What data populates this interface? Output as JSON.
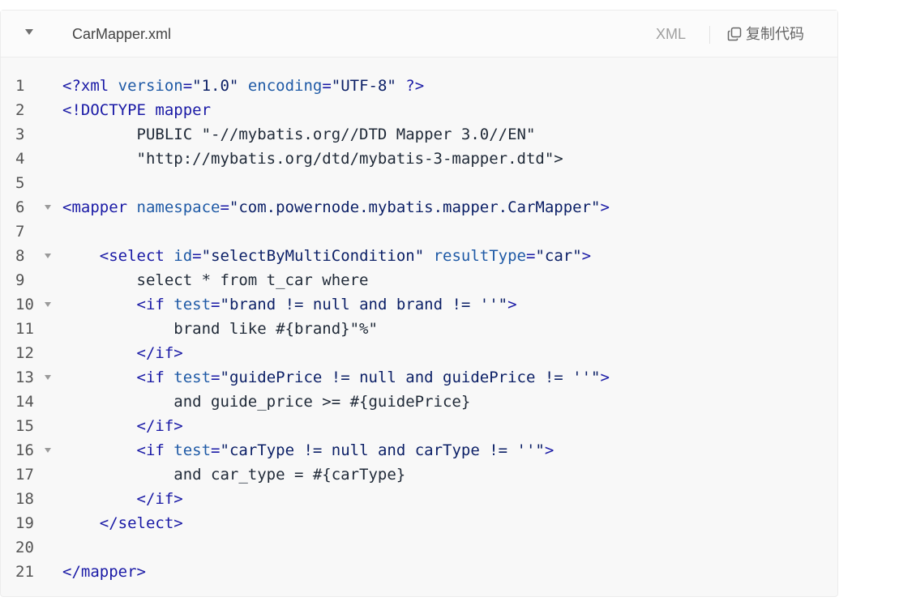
{
  "header": {
    "file_name": "CarMapper.xml",
    "language": "XML",
    "copy_label": "复制代码",
    "collapse_icon": "chevron-down-icon",
    "copy_icon": "copy-icon"
  },
  "colors": {
    "tag": "#1a1aa6",
    "attribute": "#1f5aa6",
    "string": "#0b1f66",
    "text": "#1f2937",
    "line_number": "#555555",
    "background": "#f8f8f8"
  },
  "lines": [
    {
      "number": "1",
      "fold": false,
      "text": "<?xml version=\"1.0\" encoding=\"UTF-8\" ?>"
    },
    {
      "number": "2",
      "fold": false,
      "text": "<!DOCTYPE mapper"
    },
    {
      "number": "3",
      "fold": false,
      "text": "        PUBLIC \"-//mybatis.org//DTD Mapper 3.0//EN\""
    },
    {
      "number": "4",
      "fold": false,
      "text": "        \"http://mybatis.org/dtd/mybatis-3-mapper.dtd\">"
    },
    {
      "number": "5",
      "fold": false,
      "text": ""
    },
    {
      "number": "6",
      "fold": true,
      "text": "<mapper namespace=\"com.powernode.mybatis.mapper.CarMapper\">"
    },
    {
      "number": "7",
      "fold": false,
      "text": ""
    },
    {
      "number": "8",
      "fold": true,
      "text": "    <select id=\"selectByMultiCondition\" resultType=\"car\">"
    },
    {
      "number": "9",
      "fold": false,
      "text": "        select * from t_car where"
    },
    {
      "number": "10",
      "fold": true,
      "text": "        <if test=\"brand != null and brand != ''\">"
    },
    {
      "number": "11",
      "fold": false,
      "text": "            brand like #{brand}\"%\""
    },
    {
      "number": "12",
      "fold": false,
      "text": "        </if>"
    },
    {
      "number": "13",
      "fold": true,
      "text": "        <if test=\"guidePrice != null and guidePrice != ''\">"
    },
    {
      "number": "14",
      "fold": false,
      "text": "            and guide_price >= #{guidePrice}"
    },
    {
      "number": "15",
      "fold": false,
      "text": "        </if>"
    },
    {
      "number": "16",
      "fold": true,
      "text": "        <if test=\"carType != null and carType != ''\">"
    },
    {
      "number": "17",
      "fold": false,
      "text": "            and car_type = #{carType}"
    },
    {
      "number": "18",
      "fold": false,
      "text": "        </if>"
    },
    {
      "number": "19",
      "fold": false,
      "text": "    </select>"
    },
    {
      "number": "20",
      "fold": false,
      "text": ""
    },
    {
      "number": "21",
      "fold": false,
      "text": "</mapper>"
    }
  ]
}
